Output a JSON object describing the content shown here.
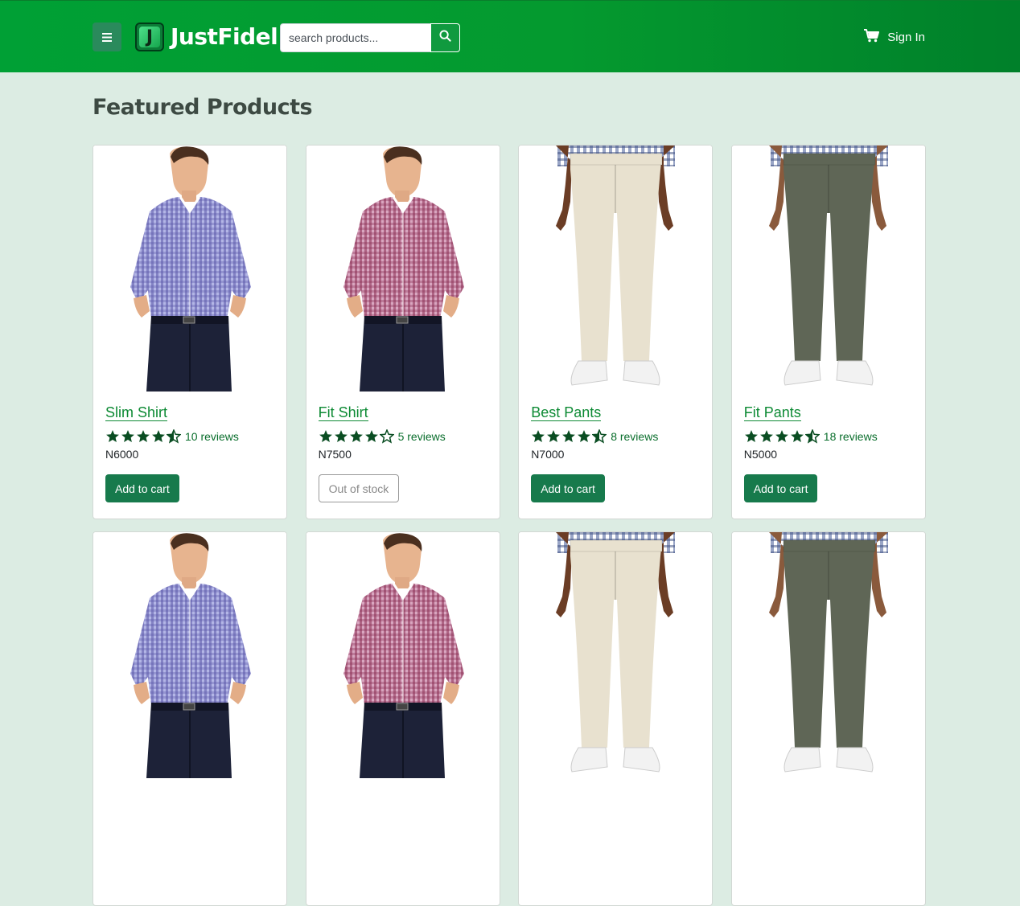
{
  "header": {
    "brand": "JustFidel",
    "logo_letter": "J",
    "search_placeholder": "search products...",
    "sign_in": "Sign In"
  },
  "page_title": "Featured Products",
  "colors": {
    "header_green": "#009a2e",
    "button_green": "#177a4c",
    "link_green": "#0d8a34",
    "star_green": "#0a4d22",
    "page_bg": "#dcece3"
  },
  "products": [
    {
      "name": "Slim Shirt",
      "rating": 4.5,
      "reviews": "10 reviews",
      "price": "N6000",
      "action": "Add to cart",
      "in_stock": true,
      "image": "shirt-purple"
    },
    {
      "name": "Fit Shirt",
      "rating": 4.0,
      "reviews": "5 reviews",
      "price": "N7500",
      "action": "Out of stock",
      "in_stock": false,
      "image": "shirt-red"
    },
    {
      "name": "Best Pants",
      "rating": 4.5,
      "reviews": "8 reviews",
      "price": "N7000",
      "action": "Add to cart",
      "in_stock": true,
      "image": "pants-beige"
    },
    {
      "name": "Fit Pants",
      "rating": 4.5,
      "reviews": "18 reviews",
      "price": "N5000",
      "action": "Add to cart",
      "in_stock": true,
      "image": "pants-olive"
    },
    {
      "image": "shirt-purple"
    },
    {
      "image": "shirt-red"
    },
    {
      "image": "pants-beige"
    },
    {
      "image": "pants-olive"
    }
  ]
}
